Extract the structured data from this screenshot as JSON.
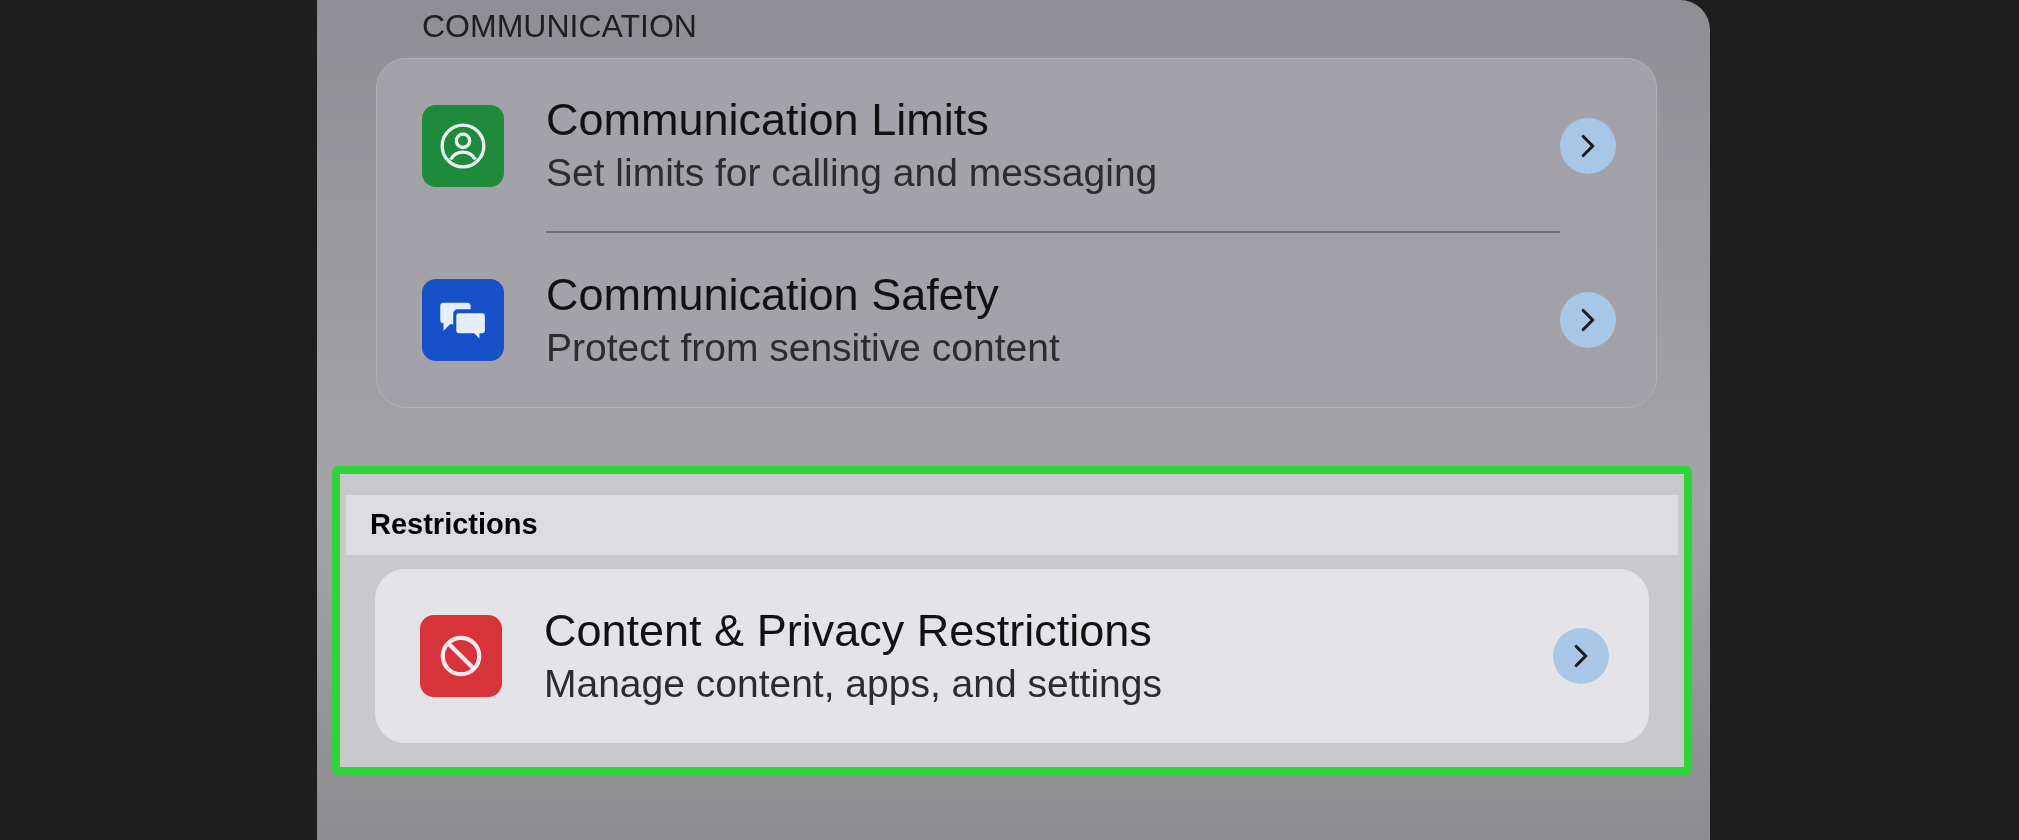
{
  "sections": [
    {
      "header": "COMMUNICATION",
      "highlighted": false,
      "items": [
        {
          "kind": "person",
          "color": "#1f8a3c",
          "title": "Communication Limits",
          "subtitle": "Set limits for calling and messaging"
        },
        {
          "kind": "bubbles",
          "color": "#1651c9",
          "title": "Communication Safety",
          "subtitle": "Protect from sensitive content"
        }
      ]
    },
    {
      "header": "Restrictions",
      "highlighted": true,
      "items": [
        {
          "kind": "block",
          "color": "#d7333a",
          "title": "Content & Privacy Restrictions",
          "subtitle": "Manage content, apps, and settings"
        }
      ]
    }
  ]
}
